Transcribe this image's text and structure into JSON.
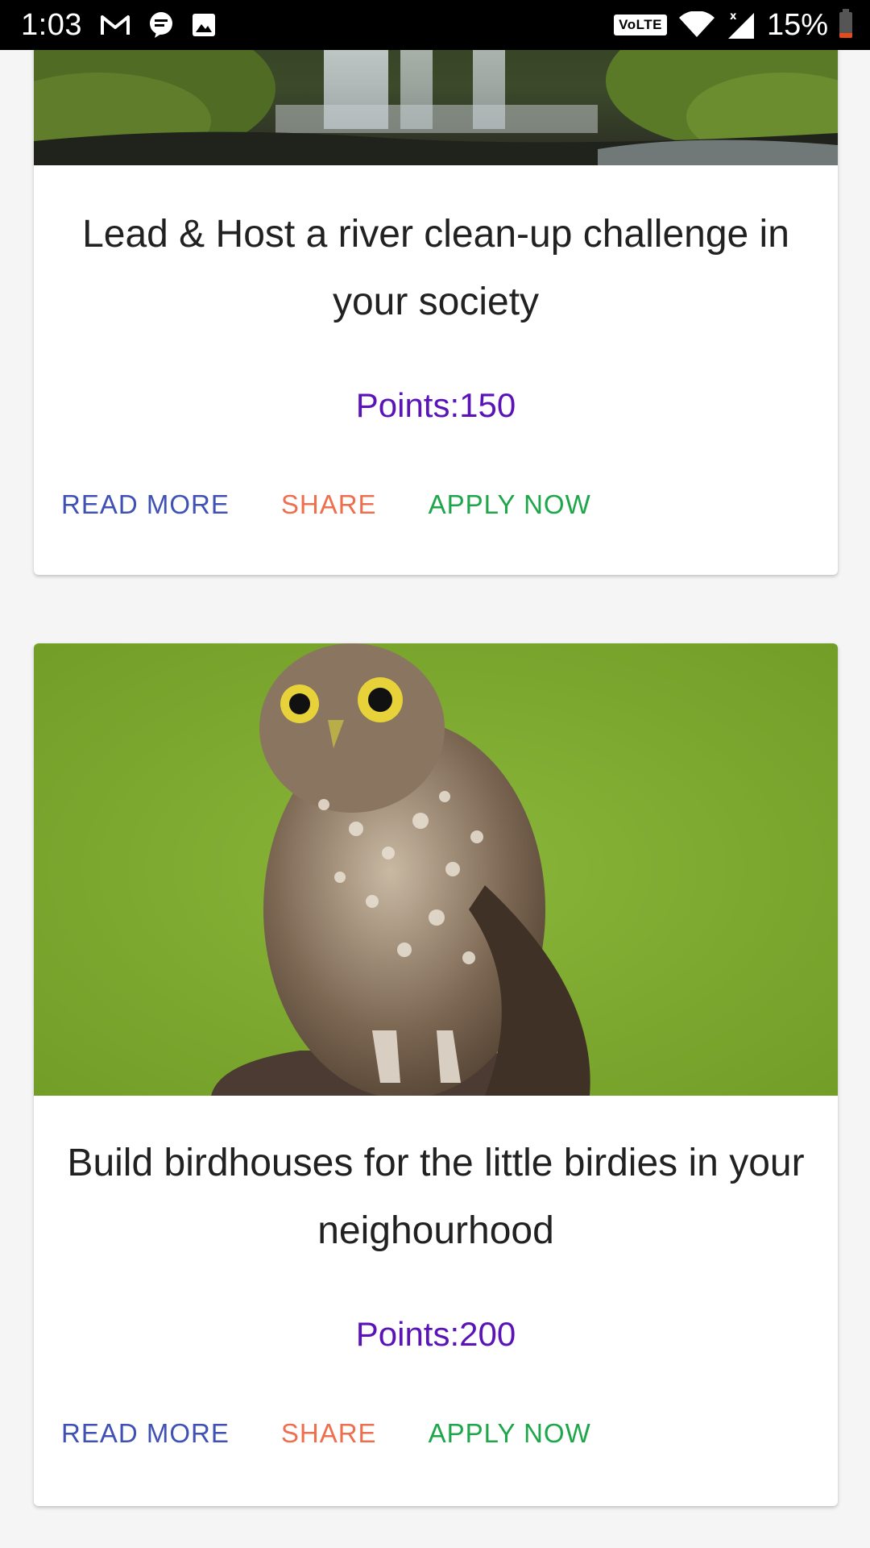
{
  "status_bar": {
    "time": "1:03",
    "network_badge": "VoLTE",
    "battery_text": "15%"
  },
  "cards": [
    {
      "title": "Lead & Host a river clean-up challenge in your society",
      "points": "Points:150",
      "read_more": "READ MORE",
      "share": "SHARE",
      "apply": "APPLY NOW"
    },
    {
      "title": "Build birdhouses for the little birdies in your neighourhood",
      "points": "Points:200",
      "read_more": "READ MORE",
      "share": "SHARE",
      "apply": "APPLY NOW"
    }
  ],
  "colors": {
    "read_more": "#3f51b5",
    "share": "#ee6f4d",
    "apply": "#1ea64a",
    "points": "#5a13b8",
    "battery_low": "#e64a19"
  }
}
